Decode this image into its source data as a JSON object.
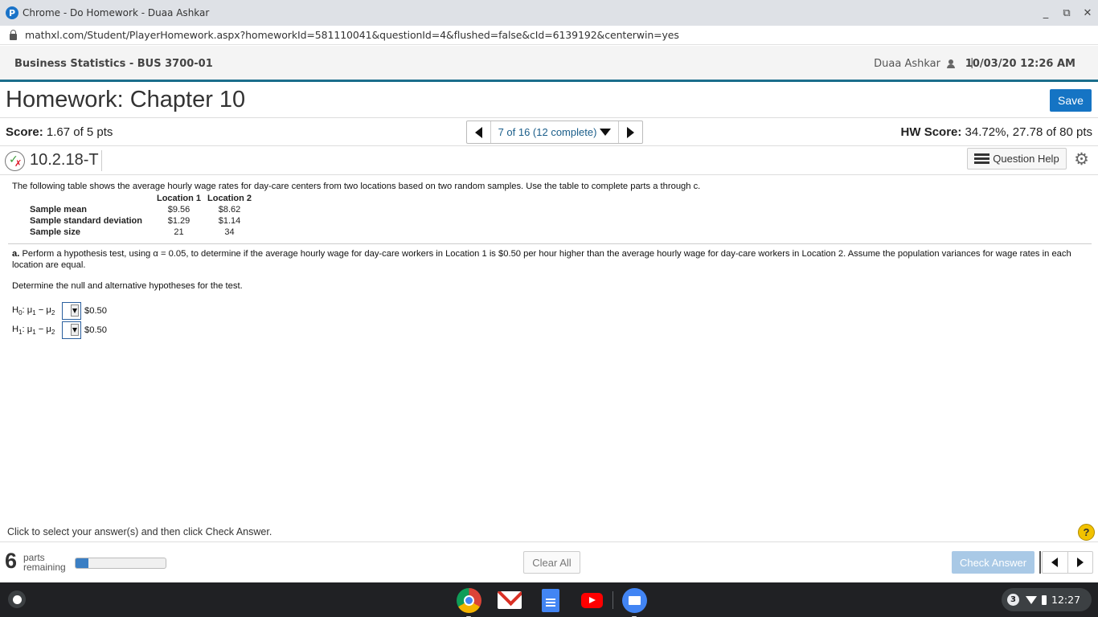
{
  "browser": {
    "window_title": "Chrome - Do Homework - Duaa Ashkar",
    "favicon_letter": "P",
    "url": "mathxl.com/Student/PlayerHomework.aspx?homeworkId=581110041&questionId=4&flushed=false&cId=6139192&centerwin=yes"
  },
  "header": {
    "course": "Business Statistics - BUS 3700-01",
    "user": "Duaa Ashkar",
    "separator": "|",
    "datetime": "10/03/20 12:26 AM"
  },
  "homework": {
    "title": "Homework: Chapter 10",
    "save_label": "Save",
    "score_label": "Score:",
    "score_value": "1.67 of 5 pts",
    "question_nav": "7 of 16 (12 complete)",
    "hw_score_label": "HW Score:",
    "hw_score_value": "34.72%, 27.78 of 80 pts"
  },
  "question": {
    "id": "10.2.18-T",
    "help_label": "Question Help",
    "intro": "The following table shows the average hourly wage rates for day-care centers from two locations based on two random samples. Use the table to complete parts a through c.",
    "table": {
      "columns": [
        "Location 1",
        "Location 2"
      ],
      "rows": [
        {
          "label": "Sample mean",
          "values": [
            "$9.56",
            "$8.62"
          ]
        },
        {
          "label": "Sample standard deviation",
          "values": [
            "$1.29",
            "$1.14"
          ]
        },
        {
          "label": "Sample size",
          "values": [
            "21",
            "34"
          ]
        }
      ]
    },
    "part_a_label": "a.",
    "part_a_text": "Perform a hypothesis test, using α = 0.05, to determine if the average hourly wage for day-care workers in Location 1 is $0.50 per hour higher than the average hourly wage for day-care workers in Location 2. Assume the population variances for wage rates in each location are equal.",
    "determine": "Determine the null and alternative hypotheses for the test.",
    "hypotheses": [
      {
        "h": "H",
        "h_sub": "0",
        "mid": ": μ",
        "s1": "1",
        "minus": " − μ",
        "s2": "2",
        "value": "$0.50"
      },
      {
        "h": "H",
        "h_sub": "1",
        "mid": ": μ",
        "s1": "1",
        "minus": " − μ",
        "s2": "2",
        "value": "$0.50"
      }
    ]
  },
  "footer": {
    "instruction": "Click to select your answer(s) and then click Check Answer.",
    "help_symbol": "?",
    "parts_count": "6",
    "parts_line1": "parts",
    "parts_line2": "remaining",
    "progress_fraction": 0.14,
    "clear_all_label": "Clear All",
    "check_answer_label": "Check Answer"
  },
  "shelf": {
    "apps": [
      "chrome-icon",
      "gmail-icon",
      "docs-icon",
      "youtube-icon",
      "files-icon"
    ],
    "notification_count": "3",
    "time": "12:27"
  },
  "colors": {
    "accent_blue": "#1574c4",
    "header_rule": "#1b6e8c",
    "check_answer_disabled": "#a9c9e6",
    "help_yellow": "#f2c200"
  }
}
